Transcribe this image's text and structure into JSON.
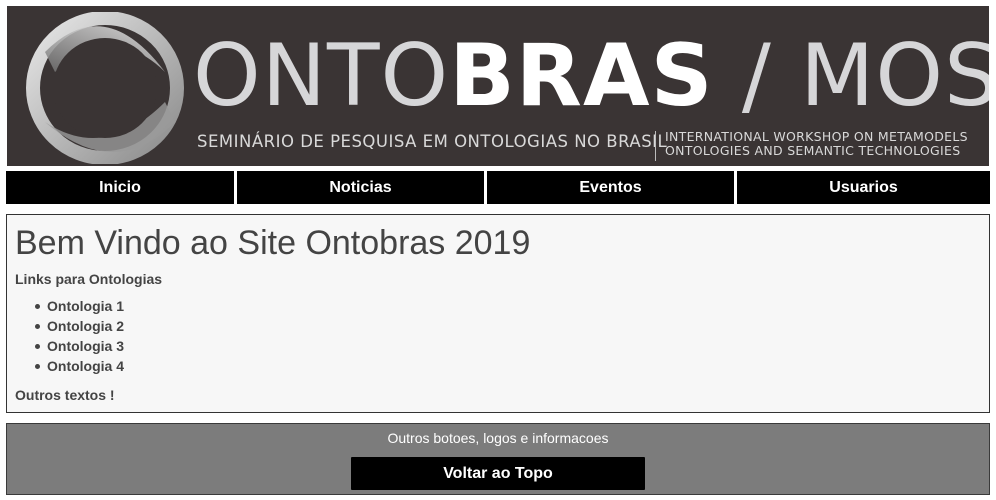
{
  "banner": {
    "title_light": "ONTO",
    "title_bold": "BRAS",
    "title_rest": " / MOST",
    "subtitle_pt": "SEMINÁRIO DE PESQUISA EM ONTOLOGIAS NO BRASIL",
    "subtitle_en_line1": "INTERNATIONAL WORKSHOP ON METAMODELS",
    "subtitle_en_line2": "ONTOLOGIES AND SEMANTIC TECHNOLOGIES",
    "logo_icon": "ring-logo-icon"
  },
  "nav": {
    "items": [
      {
        "label": "Inicio"
      },
      {
        "label": "Noticias"
      },
      {
        "label": "Eventos"
      },
      {
        "label": "Usuarios"
      }
    ]
  },
  "main": {
    "heading": "Bem Vindo ao Site Ontobras 2019",
    "links_label": "Links para Ontologias",
    "links": [
      {
        "label": "Ontologia 1"
      },
      {
        "label": "Ontologia 2"
      },
      {
        "label": "Ontologia 3"
      },
      {
        "label": "Ontologia 4"
      }
    ],
    "other_text": "Outros textos !"
  },
  "footer": {
    "info": "Outros botoes, logos e informacoes",
    "back_to_top": "Voltar ao Topo"
  },
  "colors": {
    "banner_bg": "#3a3434",
    "nav_bg": "#000000",
    "footer_bg": "#7c7c7c",
    "content_bg": "#f7f7f7"
  }
}
